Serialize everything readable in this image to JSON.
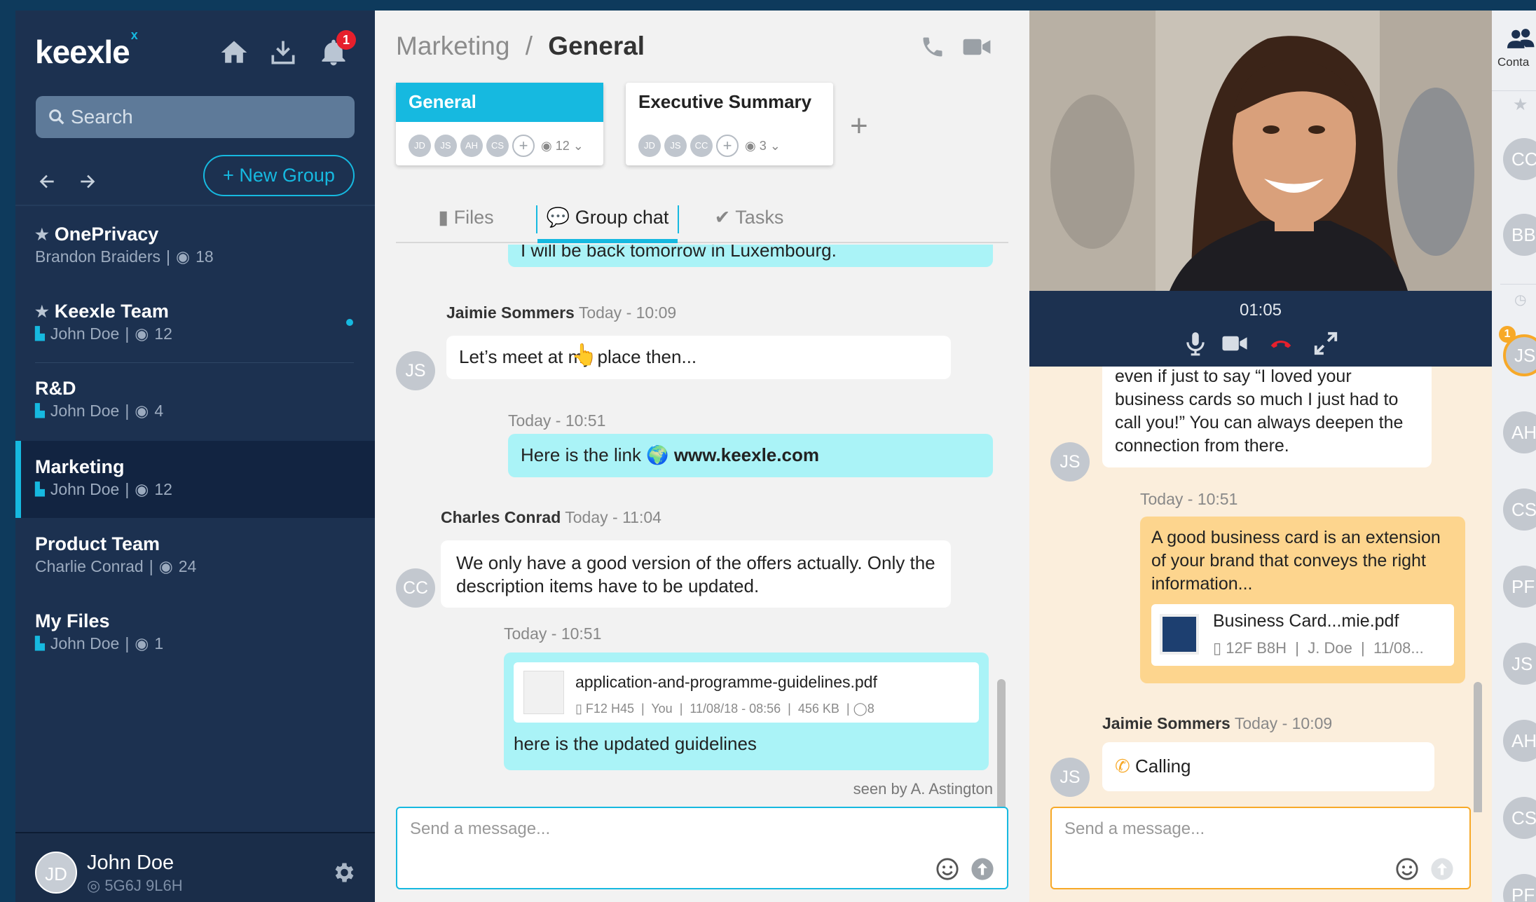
{
  "sidebar": {
    "logo": "keexle",
    "logo_mark": "x",
    "notification_count": "1",
    "search_placeholder": "Search",
    "new_group_label": "+ New Group",
    "groups": [
      {
        "name": "OnePrivacy",
        "owner": "Brandon Braiders",
        "members": "18",
        "starred": true,
        "bookmark": false,
        "unread": false,
        "active": false
      },
      {
        "name": "Keexle Team",
        "owner": "John Doe",
        "members": "12",
        "starred": true,
        "bookmark": true,
        "unread": true,
        "active": false
      },
      {
        "name": "R&D",
        "owner": "John Doe",
        "members": "4",
        "starred": false,
        "bookmark": true,
        "unread": false,
        "active": false
      },
      {
        "name": "Marketing",
        "owner": "John Doe",
        "members": "12",
        "starred": false,
        "bookmark": true,
        "unread": false,
        "active": true
      },
      {
        "name": "Product Team",
        "owner": "Charlie Conrad",
        "members": "24",
        "starred": false,
        "bookmark": false,
        "unread": false,
        "active": false
      },
      {
        "name": "My Files",
        "owner": "John Doe",
        "members": "1",
        "starred": false,
        "bookmark": true,
        "unread": false,
        "active": false
      }
    ],
    "user": {
      "initials": "JD",
      "name": "John Doe",
      "code": "5G6J 9L6H"
    }
  },
  "center": {
    "breadcrumb_parent": "Marketing",
    "breadcrumb_sep": "/",
    "breadcrumb_current": "General",
    "channels": [
      {
        "title": "General",
        "members": [
          "JD",
          "JS",
          "AH",
          "CS"
        ],
        "count": "12"
      },
      {
        "title": "Executive Summary",
        "members": [
          "JD",
          "JS",
          "CC"
        ],
        "count": "3"
      }
    ],
    "add_channel": "+",
    "tabs": {
      "files": "Files",
      "group_chat": "Group chat",
      "tasks": "Tasks"
    },
    "messages": {
      "m0_text": "I will be back tomorrow in Luxembourg.",
      "m1_author": "Jaimie Sommers",
      "m1_time": "Today - 10:09",
      "m1_avatar": "JS",
      "m1_text": "Let’s meet at my place then...",
      "m2_time": "Today - 10:51",
      "m2_text": "Here is the link",
      "m2_link": "www.keexle.com",
      "m3_author": "Charles Conrad",
      "m3_time": "Today - 11:04",
      "m3_avatar": "CC",
      "m3_text": "We only have a good version of the offers actually. Only the description items have to be updated.",
      "m4_time": "Today - 10:51",
      "m4_file_name": "application-and-programme-guidelines.pdf",
      "m4_file_meta": "F12 H45  |  You  |  11/08/18 - 08:56  |  456 KB  |",
      "m4_file_comments": "8",
      "m4_text": "here is the updated guidelines",
      "seen_by": "seen by A. Astington"
    },
    "composer_placeholder": "Send a message..."
  },
  "call": {
    "timer": "01:05",
    "messages": {
      "r1_text": "even if just to say “I loved your business cards so much I just had to call you!” You can always deepen the connection from there.",
      "r1_avatar": "JS",
      "r2_time": "Today - 10:51",
      "r2_text": "A good business card is an extension of your brand that conveys the right information...",
      "r2_file_name": "Business Card...mie.pdf",
      "r2_file_meta": "12F B8H  |  J. Doe  |  11/08...",
      "r3_author": "Jaimie Sommers",
      "r3_time": "Today - 10:09",
      "r3_avatar": "JS",
      "r3_text": "Calling"
    },
    "composer_placeholder": "Send a message..."
  },
  "contacts": {
    "label": "Conta",
    "badge": "1",
    "favorites": [
      "CC",
      "BB"
    ],
    "recent": [
      "JS",
      "AH",
      "CS",
      "PF",
      "JS",
      "AH",
      "CS",
      "PF"
    ]
  },
  "colors": {
    "accent": "#16b9e0",
    "sidebar": "#1c3150",
    "mine_bubble": "#aaf3f7",
    "call_bubble": "#fdd58e",
    "alert": "#e61f2c"
  }
}
